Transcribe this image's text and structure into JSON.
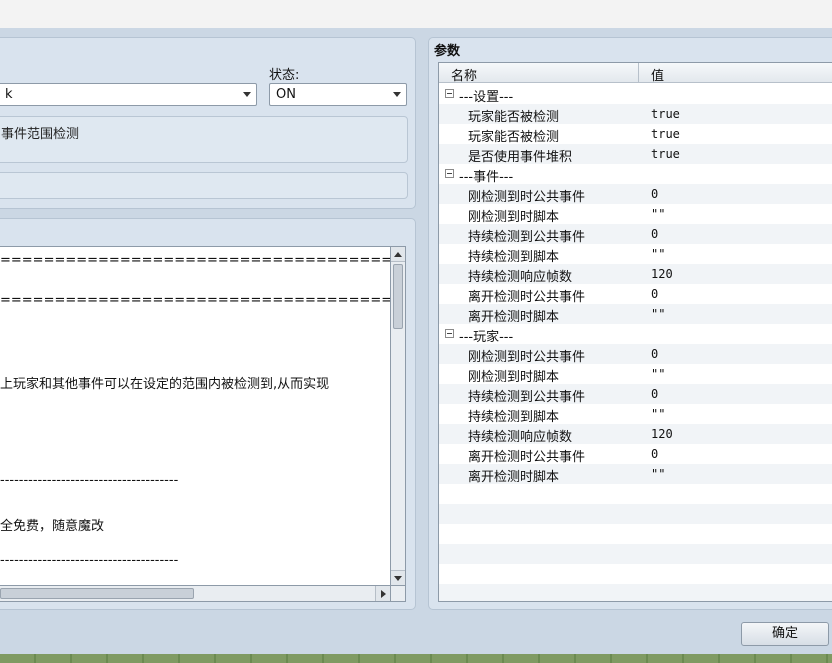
{
  "left_panel": {
    "trigger_combo_value": "k",
    "state_label": "状态:",
    "state_combo_value": "ON",
    "description_box_text": "事件范围检测",
    "note_lines": [
      "======================================================",
      "",
      "======================================================",
      "",
      "",
      "上玩家和其他事件可以在设定的范围内被检测到,从而实现",
      "",
      "",
      "",
      "--------------------------------------",
      "",
      "全免费，随意魔改",
      "",
      "--------------------------------------"
    ]
  },
  "params": {
    "title": "参数",
    "columns": [
      "名称",
      "值"
    ],
    "rows": [
      {
        "type": "group",
        "name": "---设置---"
      },
      {
        "type": "item",
        "name": "玩家能否被检测",
        "value": "true"
      },
      {
        "type": "item",
        "name": "玩家能否被检测",
        "value": "true"
      },
      {
        "type": "item",
        "name": "是否使用事件堆积",
        "value": "true"
      },
      {
        "type": "group",
        "name": "---事件---"
      },
      {
        "type": "item",
        "name": "刚检测到时公共事件",
        "value": "0"
      },
      {
        "type": "item",
        "name": "刚检测到时脚本",
        "value": "\"\""
      },
      {
        "type": "item",
        "name": "持续检测到公共事件",
        "value": "0"
      },
      {
        "type": "item",
        "name": "持续检测到脚本",
        "value": "\"\""
      },
      {
        "type": "item",
        "name": "持续检测响应帧数",
        "value": "120"
      },
      {
        "type": "item",
        "name": "离开检测时公共事件",
        "value": "0"
      },
      {
        "type": "item",
        "name": "离开检测时脚本",
        "value": "\"\""
      },
      {
        "type": "group",
        "name": "---玩家---"
      },
      {
        "type": "item",
        "name": "刚检测到时公共事件",
        "value": "0"
      },
      {
        "type": "item",
        "name": "刚检测到时脚本",
        "value": "\"\""
      },
      {
        "type": "item",
        "name": "持续检测到公共事件",
        "value": "0"
      },
      {
        "type": "item",
        "name": "持续检测到脚本",
        "value": "\"\""
      },
      {
        "type": "item",
        "name": "持续检测响应帧数",
        "value": "120"
      },
      {
        "type": "item",
        "name": "离开检测时公共事件",
        "value": "0"
      },
      {
        "type": "item",
        "name": "离开检测时脚本",
        "value": "\"\""
      }
    ]
  },
  "footer": {
    "ok_label": "确定"
  }
}
